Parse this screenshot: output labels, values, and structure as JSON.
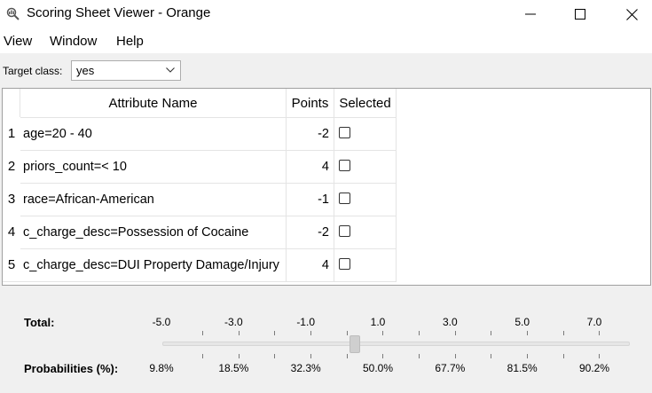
{
  "window": {
    "title": "Scoring Sheet Viewer - Orange"
  },
  "menu": [
    "View",
    "Window",
    "Help"
  ],
  "target": {
    "label": "Target class:",
    "value": "yes"
  },
  "table": {
    "headers": [
      "Attribute Name",
      "Points",
      "Selected"
    ],
    "rows": [
      {
        "index": "1",
        "attribute": "age=20 - 40",
        "points": "-2",
        "selected": false
      },
      {
        "index": "2",
        "attribute": "priors_count=< 10",
        "points": "4",
        "selected": false
      },
      {
        "index": "3",
        "attribute": "race=African-American",
        "points": "-1",
        "selected": false
      },
      {
        "index": "4",
        "attribute": "c_charge_desc=Possession of Cocaine",
        "points": "-2",
        "selected": false
      },
      {
        "index": "5",
        "attribute": "c_charge_desc=DUI Property Damage/Injury",
        "points": "4",
        "selected": false
      }
    ]
  },
  "slider": {
    "total_label": "Total:",
    "probabilities_label": "Probabilities (%):",
    "totals": [
      "-5.0",
      "-3.0",
      "-1.0",
      "1.0",
      "3.0",
      "5.0",
      "7.0"
    ],
    "probabilities": [
      "9.8%",
      "18.5%",
      "32.3%",
      "50.0%",
      "67.7%",
      "81.5%",
      "90.2%"
    ],
    "current_total": 0.0
  }
}
